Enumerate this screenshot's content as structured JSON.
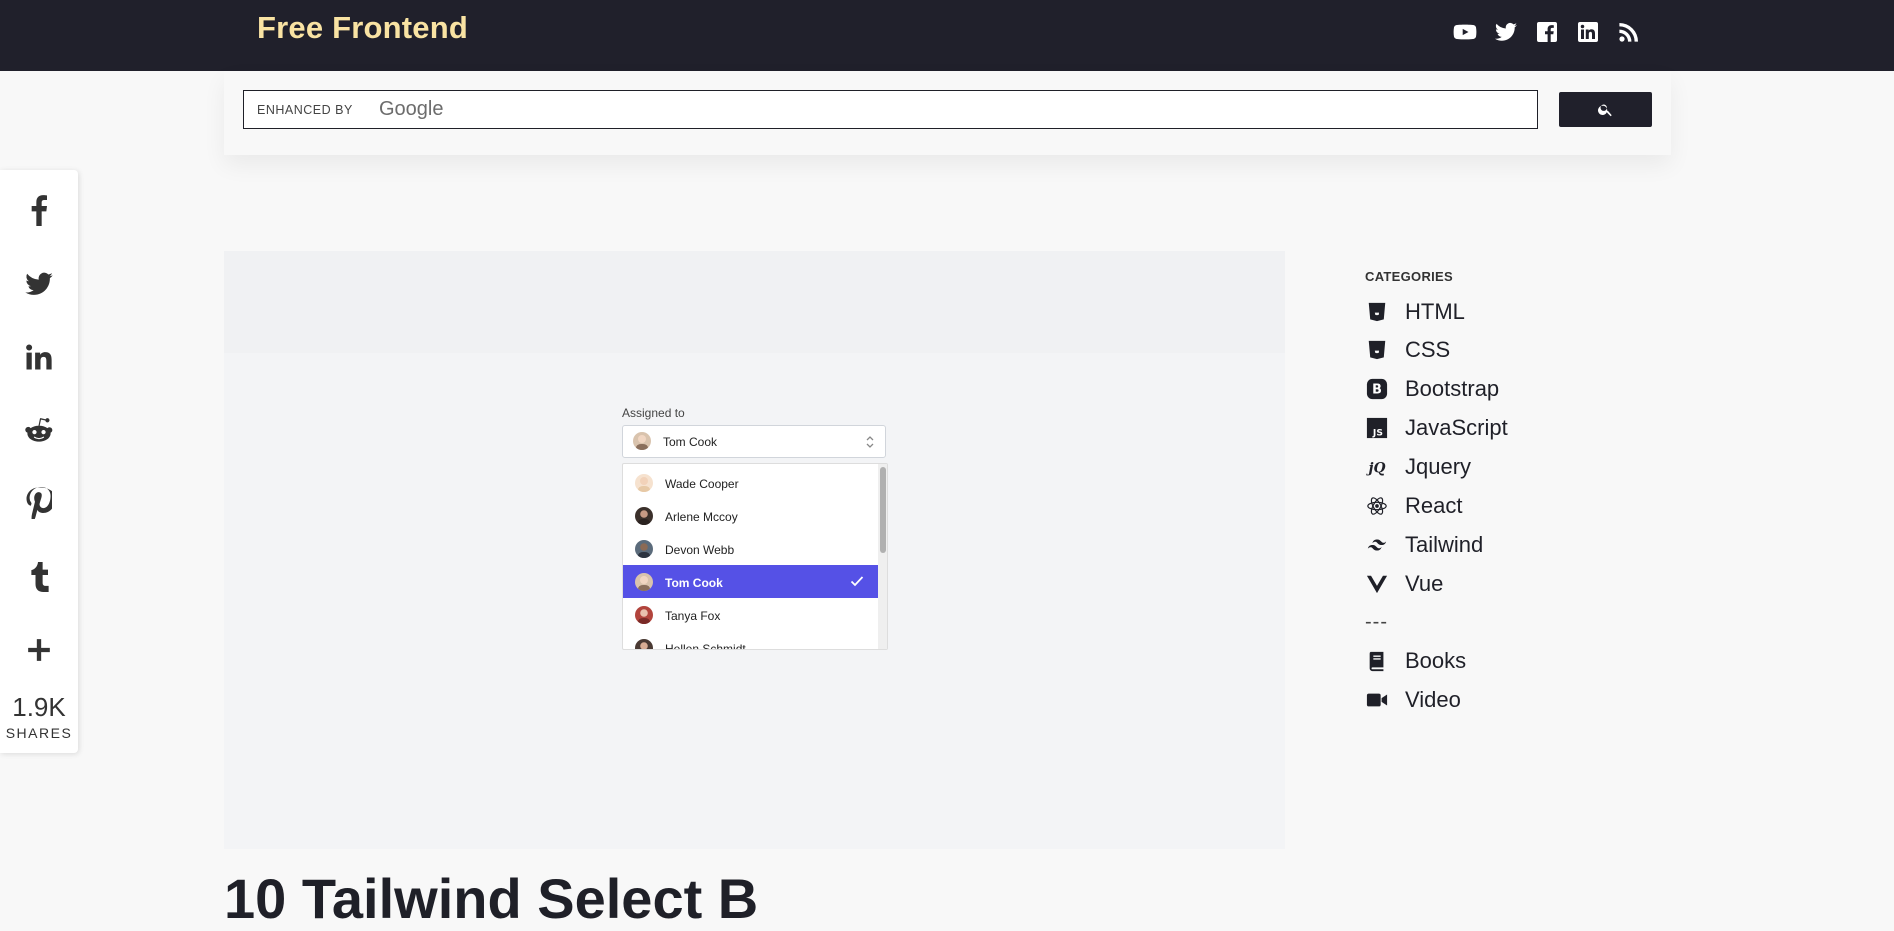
{
  "header": {
    "brand": "Free Frontend",
    "social_icons": [
      "youtube-icon",
      "twitter-icon",
      "facebook-icon",
      "linkedin-icon",
      "rss-icon"
    ]
  },
  "search": {
    "enhanced_label": "ENHANCED BY",
    "google_label": "Google",
    "button_icon": "search-icon"
  },
  "share_bar": {
    "icons": [
      "facebook-icon",
      "twitter-icon",
      "linkedin-icon",
      "reddit-icon",
      "pinterest-icon",
      "tumblr-icon",
      "plus-icon"
    ],
    "count": "1.9K",
    "label": "SHARES"
  },
  "demo": {
    "label": "Assigned to",
    "selected": "Tom Cook",
    "options": [
      "Wade Cooper",
      "Arlene Mccoy",
      "Devon Webb",
      "Tom Cook",
      "Tanya Fox",
      "Hellen Schmidt"
    ],
    "active_color": "#5551e6"
  },
  "article": {
    "title": "10 Tailwind Select B"
  },
  "sidebar": {
    "heading": "CATEGORIES",
    "items": [
      "HTML",
      "CSS",
      "Bootstrap",
      "JavaScript",
      "Jquery",
      "React",
      "Tailwind",
      "Vue"
    ],
    "separator": "---",
    "extra": [
      "Books",
      "Video"
    ]
  },
  "colors": {
    "header_bg": "#20202b",
    "brand": "#f9e3a3"
  }
}
